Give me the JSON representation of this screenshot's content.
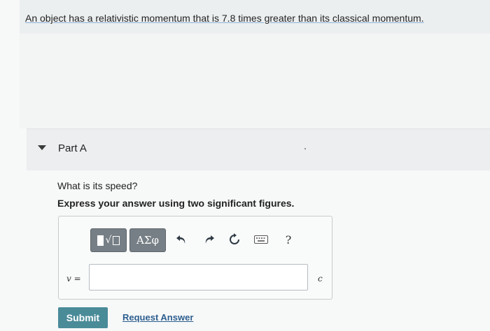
{
  "problem": {
    "text": "An object has a relativistic momentum that is 7.8 times greater than its classical momentum."
  },
  "part": {
    "title": "Part A",
    "collapse_icon": "caret-down-icon",
    "question": "What is its speed?",
    "instruction": "Express your answer using two significant figures."
  },
  "toolbar": {
    "templates_icon": "templates-icon",
    "greek_label": "ΑΣφ",
    "undo_icon": "undo-icon",
    "redo_icon": "redo-icon",
    "reset_icon": "reset-icon",
    "keyboard_icon": "keyboard-icon",
    "help_label": "?"
  },
  "answer": {
    "variable_label": "v =",
    "value": "",
    "unit": "c"
  },
  "actions": {
    "submit_label": "Submit",
    "request_label": "Request Answer"
  }
}
